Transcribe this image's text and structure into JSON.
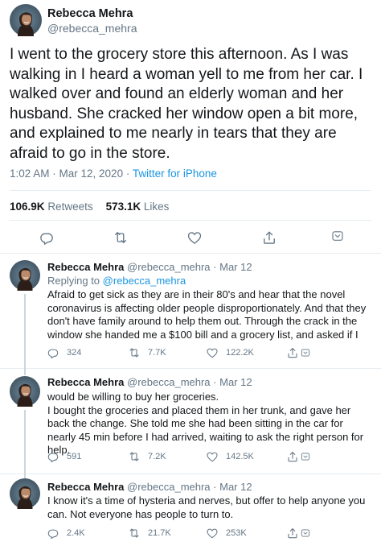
{
  "main_tweet": {
    "author_name": "Rebecca Mehra",
    "author_handle": "@rebecca_mehra",
    "text": "I went to the grocery store this afternoon. As I was walking in I heard a woman yell to me from her car. I walked over and found an elderly woman and her husband. She cracked her window open a bit more, and explained to me nearly in tears that they are afraid to go in the store.",
    "timestamp": "1:02 AM · Mar 12, 2020 · ",
    "source": "Twitter for iPhone",
    "retweets_count": "106.9K",
    "retweets_label": "Retweets",
    "likes_count": "573.1K",
    "likes_label": "Likes"
  },
  "replies": [
    {
      "name": "Rebecca Mehra",
      "handle": "@rebecca_mehra",
      "time": "· Mar 12",
      "replying_label": "Replying to",
      "replying_to": "@rebecca_mehra",
      "text": "Afraid to get sick as they are in their 80's and hear that the novel coronavirus is affecting older people disproportionately. And that they don't have family around to help them out. Through the crack in the window she handed me a $100 bill and a grocery list, and asked if I",
      "replies": "324",
      "retweets": "7.7K",
      "likes": "122.2K"
    },
    {
      "name": "Rebecca Mehra",
      "handle": "@rebecca_mehra",
      "time": "· Mar 12",
      "text": "would be willing to buy her groceries.\nI bought the groceries and placed them in her trunk, and gave her back the change. She told me she had been sitting in the car for nearly 45 min before I had arrived, waiting to ask the right person for help.",
      "replies": "591",
      "retweets": "7.2K",
      "likes": "142.5K"
    },
    {
      "name": "Rebecca Mehra",
      "handle": "@rebecca_mehra",
      "time": "· Mar 12",
      "text": "I know it's a time of hysteria and nerves, but offer to help anyone you can. Not everyone has people to turn to.",
      "replies": "2.4K",
      "retweets": "21.7K",
      "likes": "253K"
    }
  ],
  "icons": {
    "reply": "speech-bubble-icon",
    "retweet": "retweet-arrows-icon",
    "like": "heart-icon",
    "share": "share-upload-icon",
    "caret": "chevron-down-icon"
  },
  "colors": {
    "text": "#14171a",
    "secondary": "#657786",
    "link": "#1b95e0",
    "divider": "#e6ecf0"
  }
}
